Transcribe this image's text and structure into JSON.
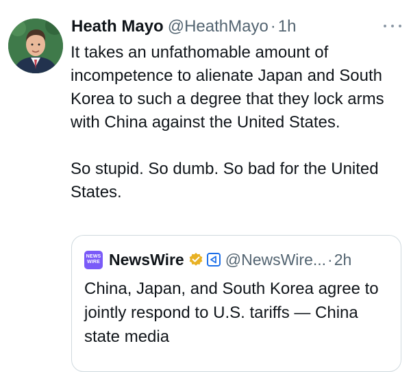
{
  "tweet": {
    "author_name": "Heath Mayo",
    "handle": "@HeathMayo",
    "separator": "·",
    "time": "1h",
    "paragraphs": [
      "It takes an unfathomable amount of incompetence to alienate Japan and South Korea to such a degree that they lock arms with China against the United States.",
      "So stupid. So dumb. So bad for the United States."
    ]
  },
  "quote": {
    "avatar_line1": "NEWS",
    "avatar_line2": "WIRE",
    "name": "NewsWire",
    "handle": "@NewsWire...",
    "separator": "·",
    "time": "2h",
    "text": "China, Japan, and South Korea agree to jointly respond to U.S. tariffs — China state media"
  },
  "icons": {
    "more": "more-horizontal-icon",
    "verified": "verified-badge-icon",
    "affiliate": "affiliate-badge-icon"
  },
  "colors": {
    "text": "#0f1419",
    "secondary": "#536471",
    "border": "#cfd9de",
    "verified_gold": "#e8b124",
    "newswire_purple": "#7a5af8",
    "affiliate_blue": "#1d6fe8"
  }
}
